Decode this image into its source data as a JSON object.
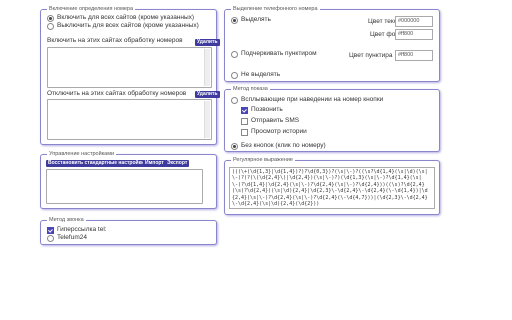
{
  "detection": {
    "legend": "Включение определения номера",
    "radio_all": "Включить для всех сайтов (кроме указанных)",
    "radio_none": "Выключить для всех сайтов (кроме указанных)",
    "enable_label": "Включить на этих сайтах обработку номеров",
    "disable_label": "Отключить на этих сайтах обработку номеров",
    "enable_list": "",
    "disable_list": "",
    "clear_button": "Удалить"
  },
  "highlight": {
    "legend": "Выделение телефонного номера",
    "option_highlight": "Выделять",
    "text_color_label": "Цвет текста",
    "text_color_value": "#000000",
    "bg_color_label": "Цвет фона",
    "bg_color_value": "#ff800",
    "option_underline": "Подчеркивать пунктиром",
    "underline_color_label": "Цвет пунктира",
    "underline_color_value": "#ff800",
    "option_none": "Не выделять"
  },
  "display": {
    "legend": "Метод показа",
    "option_hover": "Всплывающие при наведении на номер кнопки",
    "call": "Позвонить",
    "sms": "Отправить SMS",
    "history": "Просмотр истории",
    "option_click": "Без кнопок (клик по номеру)"
  },
  "settings": {
    "legend": "Управление настройками",
    "restore": "Восстановить стандартные настройки",
    "import": "Импорт",
    "export": "Экспорт"
  },
  "regex": {
    "legend": "Регулярное выражение",
    "value": "(((\\+(\\d{1,3}|\\d{1,4})?)?\\d{0,3})?(\\s|\\-)?((\\s?\\d{1,4}(\\s|\\d)(\\s|\\-)?)?(\\(\\d{2,4}\\)|\\d{2,4})(\\s|\\-)?)(\\d{1,3}(\\s|\\-)?\\d{1,4}(\\s|\\-)?\\d{1,4}|\\d{2,4}(\\s|\\-)?\\d{2,4}(\\s|\\-)?\\d{2,4}))((\\s)?\\d{2,4}(\\s)?\\d{2,4})(\\s|\\d){2,4}|\\d{2,3}\\-\\d{2,4}\\-\\d{2,4}(\\-\\d{1,4})|\\d{2,4}(\\s|\\-)?\\d{2,4}(\\s|\\-)?\\d{2,4}(\\-\\d{4,7}))|(\\d{2,3}\\-\\d{2,4}\\-\\d{2,4}(\\s|\\d){2,4}(\\d{2}))"
  },
  "call_method": {
    "legend": "Метод звонка",
    "hyperlink": "Гиперссылка tel:",
    "telefum": "Telefum24"
  },
  "colors": {
    "accent": "#3f3b9e",
    "border": "#8a86cc"
  }
}
